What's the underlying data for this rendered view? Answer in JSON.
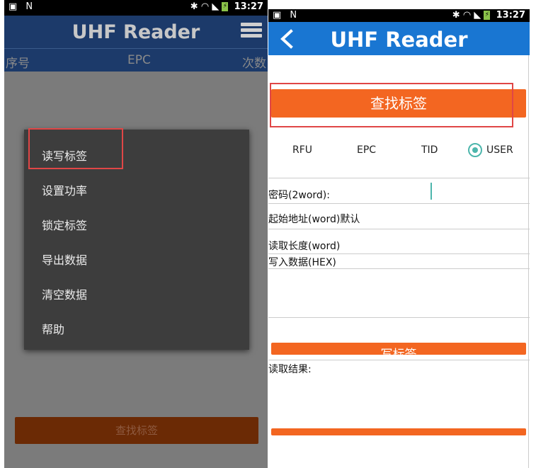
{
  "left": {
    "status_bar": {
      "time": "13:27",
      "left_icons": [
        "image-icon",
        "notification-n-icon"
      ],
      "right_icons": [
        "bluetooth-icon",
        "wifi-icon",
        "no-sim-icon",
        "battery-icon"
      ]
    },
    "app_title": "UHF Reader",
    "table_header": {
      "col1": "序号",
      "col2": "EPC",
      "col3": "次数"
    },
    "menu_items": [
      "读写标签",
      "设置功率",
      "锁定标签",
      "导出数据",
      "清空数据",
      "帮助"
    ],
    "find_button": "查找标签"
  },
  "right": {
    "status_bar": {
      "time": "13:27"
    },
    "app_title": "UHF Reader",
    "find_button": "查找标签",
    "radio_options": [
      "RFU",
      "EPC",
      "TID",
      "USER"
    ],
    "radio_selected": "USER",
    "fields": {
      "password": "密码(2word):",
      "start_addr": "起始地址(word)默认",
      "read_len": "读取长度(word)",
      "write_data": "写入数据(HEX)"
    },
    "write_button": "写标签",
    "read_result_label": "读取结果:"
  },
  "colors": {
    "orange": "#f36621",
    "blue_appbar": "#1976d2",
    "dark_appbar": "#1c3a6a",
    "teal": "#4db6ac",
    "highlight_red": "#e04646"
  }
}
